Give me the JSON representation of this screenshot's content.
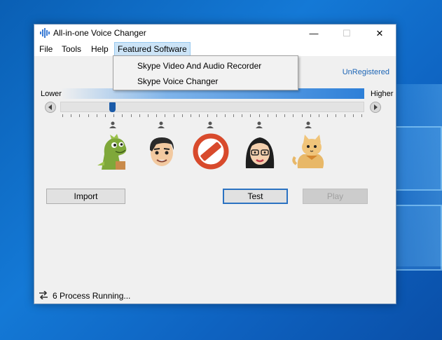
{
  "window": {
    "title": "All-in-one Voice Changer",
    "minimize": "—",
    "maximize": "☐",
    "close": "✕"
  },
  "menu": {
    "items": [
      "File",
      "Tools",
      "Help",
      "Featured Software"
    ],
    "dropdown": [
      "Skype Video And Audio Recorder",
      "Skype Voice Changer"
    ]
  },
  "license_status": "UnRegistered",
  "pitch": {
    "lower_label": "Lower",
    "higher_label": "Higher",
    "level": 0.17
  },
  "voice_presets": [
    {
      "icon": "dragon-icon"
    },
    {
      "icon": "man-face-icon"
    },
    {
      "icon": "no-effect-icon"
    },
    {
      "icon": "woman-face-icon"
    },
    {
      "icon": "cat-icon"
    }
  ],
  "buttons": {
    "import": "Import",
    "test": "Test",
    "play": "Play"
  },
  "status": {
    "text": "6 Process Running..."
  },
  "colors": {
    "accent": "#2d7fd8",
    "link": "#1b64b5",
    "thumb": "#1a5aa8"
  }
}
